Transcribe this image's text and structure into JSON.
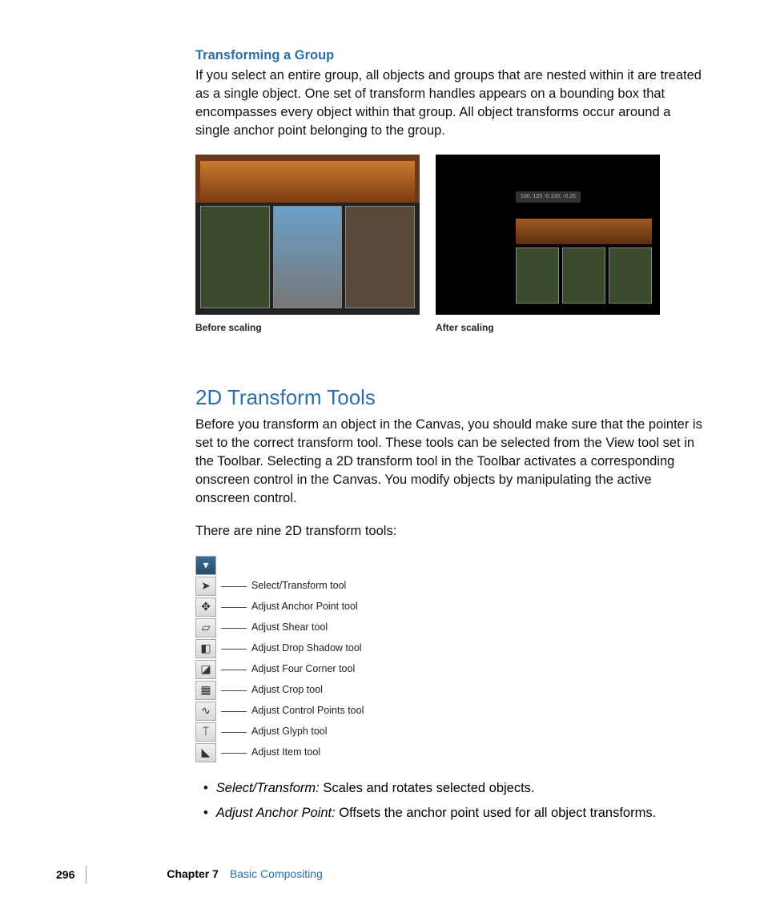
{
  "section1": {
    "heading": "Transforming a Group",
    "paragraph": "If you select an entire group, all objects and groups that are nested within it are treated as a single object. One set of transform handles appears on a bounding box that encompasses every object within that group. All object transforms occur around a single anchor point belonging to the group."
  },
  "figures": {
    "before_caption": "Before scaling",
    "after_caption": "After scaling",
    "after_badge": "100, 120\n-0.100, -0.26"
  },
  "section2": {
    "title": "2D Transform Tools",
    "para1": "Before you transform an object in the Canvas, you should make sure that the pointer is set to the correct transform tool. These tools can be selected from the View tool set in the Toolbar. Selecting a 2D transform tool in the Toolbar activates a corresponding onscreen control in the Canvas. You modify objects by manipulating the active onscreen control.",
    "para2": "There are nine 2D transform tools:"
  },
  "tools": [
    {
      "icon": "▾",
      "label": "",
      "header": true
    },
    {
      "icon": "➤",
      "label": "Select/Transform tool"
    },
    {
      "icon": "✥",
      "label": "Adjust Anchor Point tool"
    },
    {
      "icon": "▱",
      "label": "Adjust Shear tool"
    },
    {
      "icon": "◧",
      "label": "Adjust Drop Shadow tool"
    },
    {
      "icon": "◪",
      "label": "Adjust Four Corner tool"
    },
    {
      "icon": "▦",
      "label": "Adjust Crop tool"
    },
    {
      "icon": "∿",
      "label": "Adjust Control Points tool"
    },
    {
      "icon": "⍑",
      "label": "Adjust Glyph tool"
    },
    {
      "icon": "◣",
      "label": "Adjust Item tool"
    }
  ],
  "bullets": [
    {
      "term": "Select/Transform:",
      "desc": " Scales and rotates selected objects."
    },
    {
      "term": "Adjust Anchor Point:",
      "desc": " Offsets the anchor point used for all object transforms."
    }
  ],
  "footer": {
    "page": "296",
    "chapter_label": "Chapter 7",
    "chapter_title": "Basic Compositing"
  }
}
